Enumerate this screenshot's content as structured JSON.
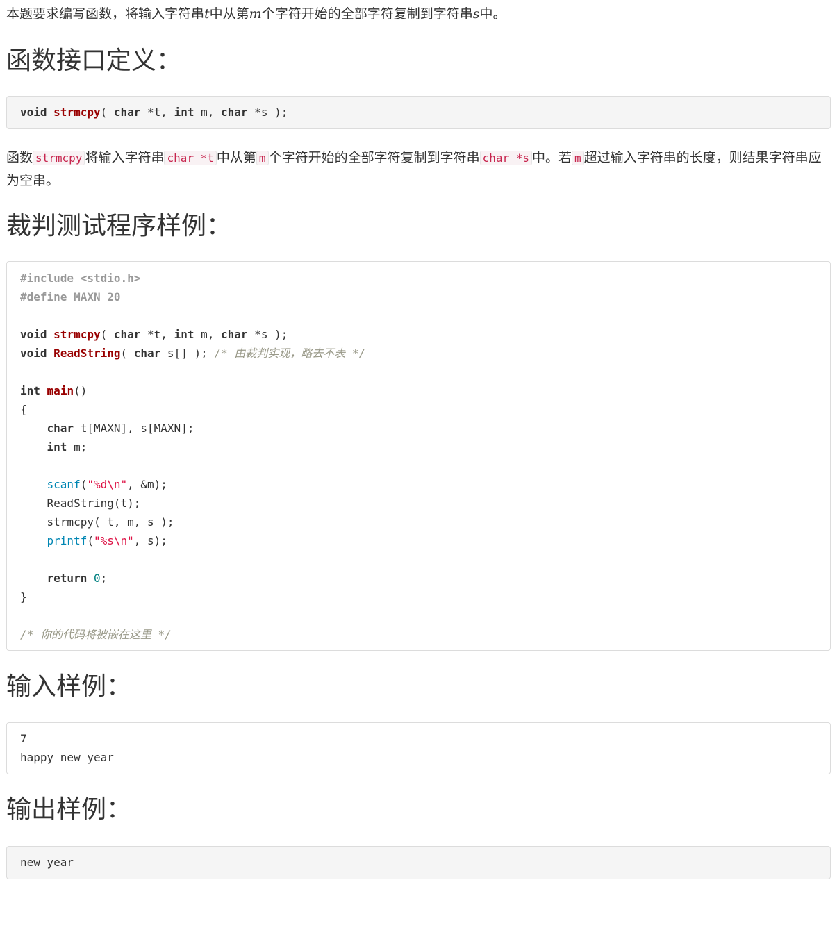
{
  "intro": {
    "part1": "本题要求编写函数，将输入字符串",
    "var_t": "t",
    "part2": "中从第",
    "var_m": "m",
    "part3": "个字符开始的全部字符复制到字符串",
    "var_s": "s",
    "part4": "中。"
  },
  "sections": {
    "interface_title": "函数接口定义：",
    "judge_title": "裁判测试程序样例：",
    "input_title": "输入样例：",
    "output_title": "输出样例："
  },
  "interface_code": {
    "kw_void": "void",
    "fn_name": "strmcpy",
    "p1": "( ",
    "kw_char1": "char",
    "p2": " *t, ",
    "kw_int": "int",
    "p3": " m, ",
    "kw_char2": "char",
    "p4": " *s );"
  },
  "description": {
    "d1": "函数",
    "c1": "strmcpy",
    "d2": "将输入字符串",
    "c2": "char *t",
    "d3": "中从第",
    "c3": "m",
    "d4": "个字符开始的全部字符复制到字符串",
    "c4": "char *s",
    "d5": "中。若",
    "c5": "m",
    "d6": "超过输入字符串的长度，则结果字符串应为空串。"
  },
  "judge_code": {
    "l1": "#include <stdio.h>",
    "l2": "#define MAXN 20",
    "l4_kw": "void",
    "l4_fn": "strmcpy",
    "l4_a": "( ",
    "l4_k2": "char",
    "l4_b": " *t, ",
    "l4_k3": "int",
    "l4_c": " m, ",
    "l4_k4": "char",
    "l4_d": " *s );",
    "l5_kw": "void",
    "l5_fn": "ReadString",
    "l5_a": "( ",
    "l5_k2": "char",
    "l5_b": " s[] ); ",
    "l5_cmt": "/* 由裁判实现，略去不表 */",
    "l7_kw": "int",
    "l7_fn": "main",
    "l7_a": "()",
    "l8": "{",
    "l9_kw": "char",
    "l9_a": " t[MAXN], s[MAXN];",
    "l10_kw": "int",
    "l10_a": " m;",
    "l12_fn": "scanf",
    "l12_a": "(",
    "l12_str": "\"%d\\n\"",
    "l12_b": ", &m);",
    "l13": "ReadString(t);",
    "l14": "strmcpy( t, m, s );",
    "l15_fn": "printf",
    "l15_a": "(",
    "l15_str": "\"%s\\n\"",
    "l15_b": ", s);",
    "l17_kw": "return",
    "l17_num": "0",
    "l17_a": ";",
    "l18": "}",
    "l20_cmt": "/* 你的代码将被嵌在这里 */"
  },
  "input_sample": {
    "line1": "7",
    "line2": "happy new year"
  },
  "output_sample": {
    "line1": "new year"
  },
  "icons": {
    "copy": "clipboard-copy-icon",
    "accent": "#1f7bd6"
  }
}
